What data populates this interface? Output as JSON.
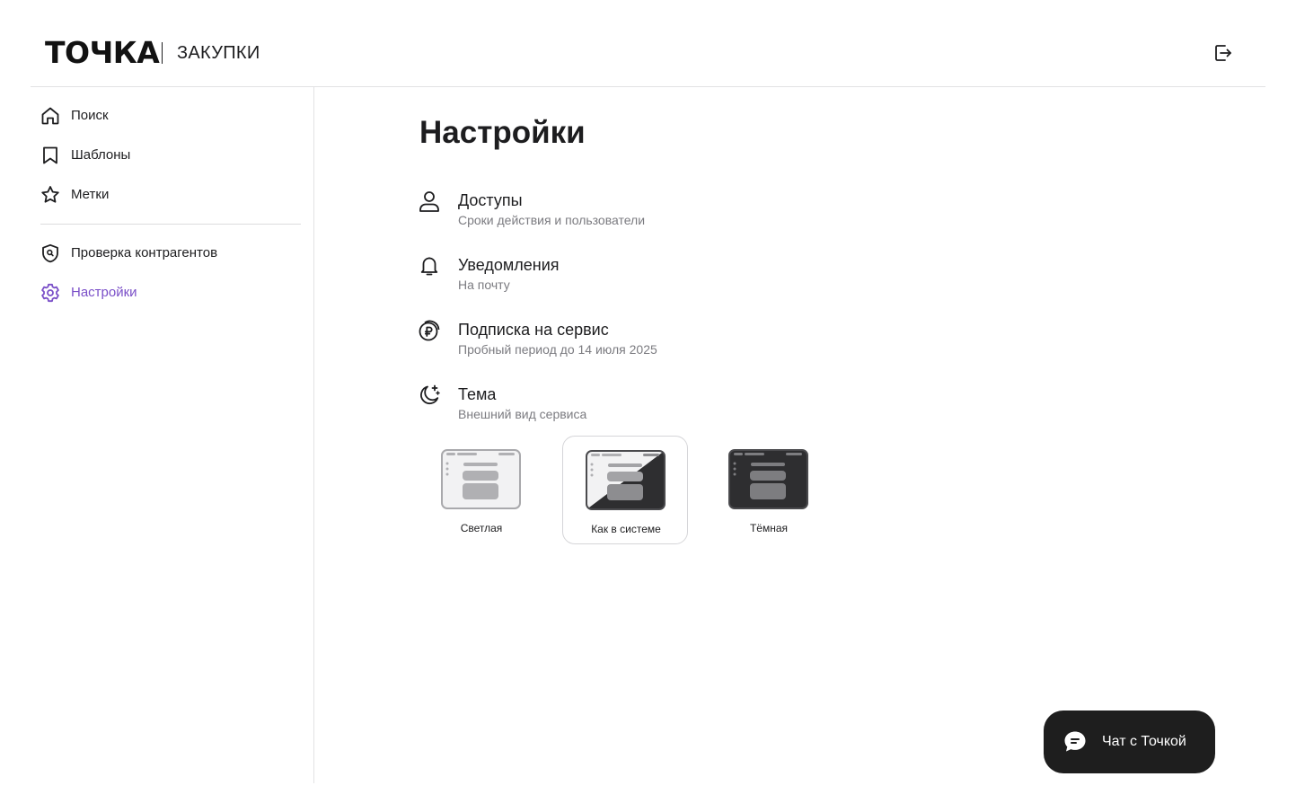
{
  "header": {
    "logo": "ТОЧКА",
    "product": "ЗАКУПКИ",
    "logout_icon": "logout-icon"
  },
  "sidebar": {
    "items": [
      {
        "label": "Поиск",
        "icon": "home-icon"
      },
      {
        "label": "Шаблоны",
        "icon": "bookmark-icon"
      },
      {
        "label": "Метки",
        "icon": "star-icon"
      },
      {
        "label": "Проверка контрагентов",
        "icon": "shield-search-icon"
      },
      {
        "label": "Настройки",
        "icon": "gear-icon",
        "active": true
      }
    ]
  },
  "main": {
    "title": "Настройки",
    "settings": [
      {
        "title": "Доступы",
        "subtitle": "Сроки действия и пользователи",
        "icon": "user-icon"
      },
      {
        "title": "Уведомления",
        "subtitle": "На почту",
        "icon": "bell-icon"
      },
      {
        "title": "Подписка на сервис",
        "subtitle": "Пробный период до 14 июля 2025",
        "icon": "ruble-coins-icon"
      },
      {
        "title": "Тема",
        "subtitle": "Внешний вид сервиса",
        "icon": "moon-stars-icon"
      }
    ],
    "themes": [
      {
        "label": "Светлая",
        "selected": false
      },
      {
        "label": "Как в системе",
        "selected": true
      },
      {
        "label": "Тёмная",
        "selected": false
      }
    ]
  },
  "chat": {
    "label": "Чат с Точкой",
    "icon": "chat-bubble-icon"
  },
  "colors": {
    "accent": "#7a4fc8",
    "text": "#1d1d1f",
    "muted": "#7b7b80",
    "chat_bg": "#1e1e1e"
  }
}
